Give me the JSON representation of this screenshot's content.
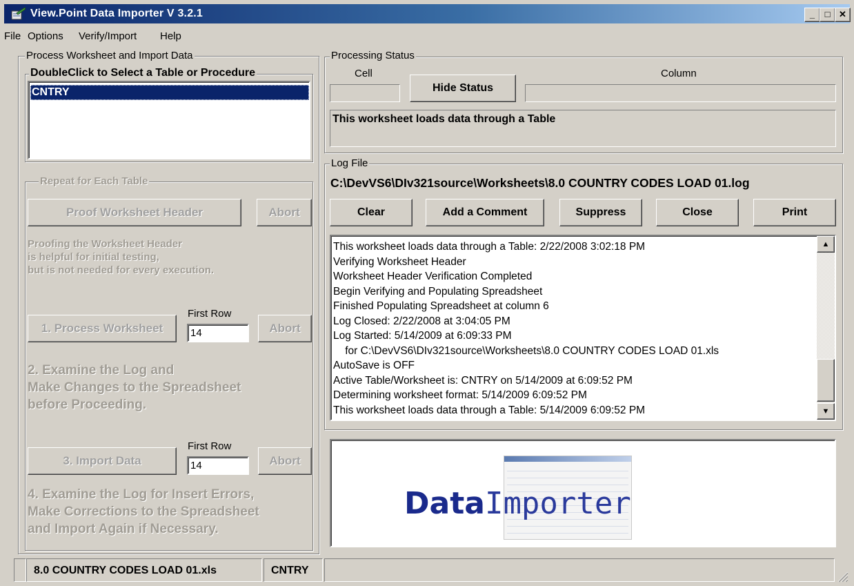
{
  "window": {
    "title": "View.Point Data Importer V 3.2.1"
  },
  "menu": [
    "File",
    "Options",
    "Verify/Import",
    "Help"
  ],
  "left": {
    "group_title": "Process Worksheet and Import Data",
    "list_title": "DoubleClick to Select a Table or Procedure",
    "list_items": [
      "CNTRY"
    ],
    "repeat_title": "Repeat for Each Table",
    "proof_button": "Proof Worksheet Header",
    "abort_label": "Abort",
    "proof_note": [
      "Proofing the Worksheet Header",
      "is helpful for initial testing,",
      "but is not needed for every execution."
    ],
    "process_button": "1. Process Worksheet",
    "first_row_label": "First Row",
    "first_row_value": "14",
    "step2": [
      "2. Examine the Log and",
      "Make Changes to the Spreadsheet",
      "before Proceeding."
    ],
    "import_button": "3. Import Data",
    "step4": [
      "4. Examine the Log for Insert Errors,",
      "Make Corrections to the Spreadsheet",
      "and Import Again if Necessary."
    ]
  },
  "status": {
    "group_title": "Processing Status",
    "cell_label": "Cell",
    "column_label": "Column",
    "hide_button": "Hide Status",
    "message": "This worksheet loads data through a Table"
  },
  "log": {
    "group_title": "Log File",
    "path": "C:\\DevVS6\\DIv321source\\Worksheets\\8.0 COUNTRY CODES LOAD 01.log",
    "buttons": [
      "Clear",
      "Add a Comment",
      "Suppress",
      "Close",
      "Print"
    ],
    "lines": [
      "This worksheet loads data through a Table: 2/22/2008  3:02:18 PM",
      "Verifying Worksheet Header",
      "Worksheet Header Verification Completed",
      "Begin Verifying and Populating Spreadsheet",
      "Finished Populating Spreadsheet at column  6",
      "Log Closed:  2/22/2008 at 3:04:05 PM",
      "Log Started: 5/14/2009 at 6:09:33 PM",
      "    for C:\\DevVS6\\DIv321source\\Worksheets\\8.0 COUNTRY CODES LOAD 01.xls",
      "AutoSave is OFF",
      "Active Table/Worksheet is: CNTRY on 5/14/2009 at 6:09:52 PM",
      "Determining worksheet format: 5/14/2009  6:09:52 PM",
      "This worksheet loads data through a Table: 5/14/2009  6:09:52 PM"
    ]
  },
  "logo": {
    "bold": "Data",
    "light": "Importer"
  },
  "statusbar": {
    "file": "8.0 COUNTRY CODES LOAD 01.xls",
    "table": "CNTRY"
  },
  "colors": {
    "title_start": "#0a246a",
    "title_end": "#a6caf0",
    "selection": "#0a246a",
    "logo_blue": "#1a2a8c"
  }
}
